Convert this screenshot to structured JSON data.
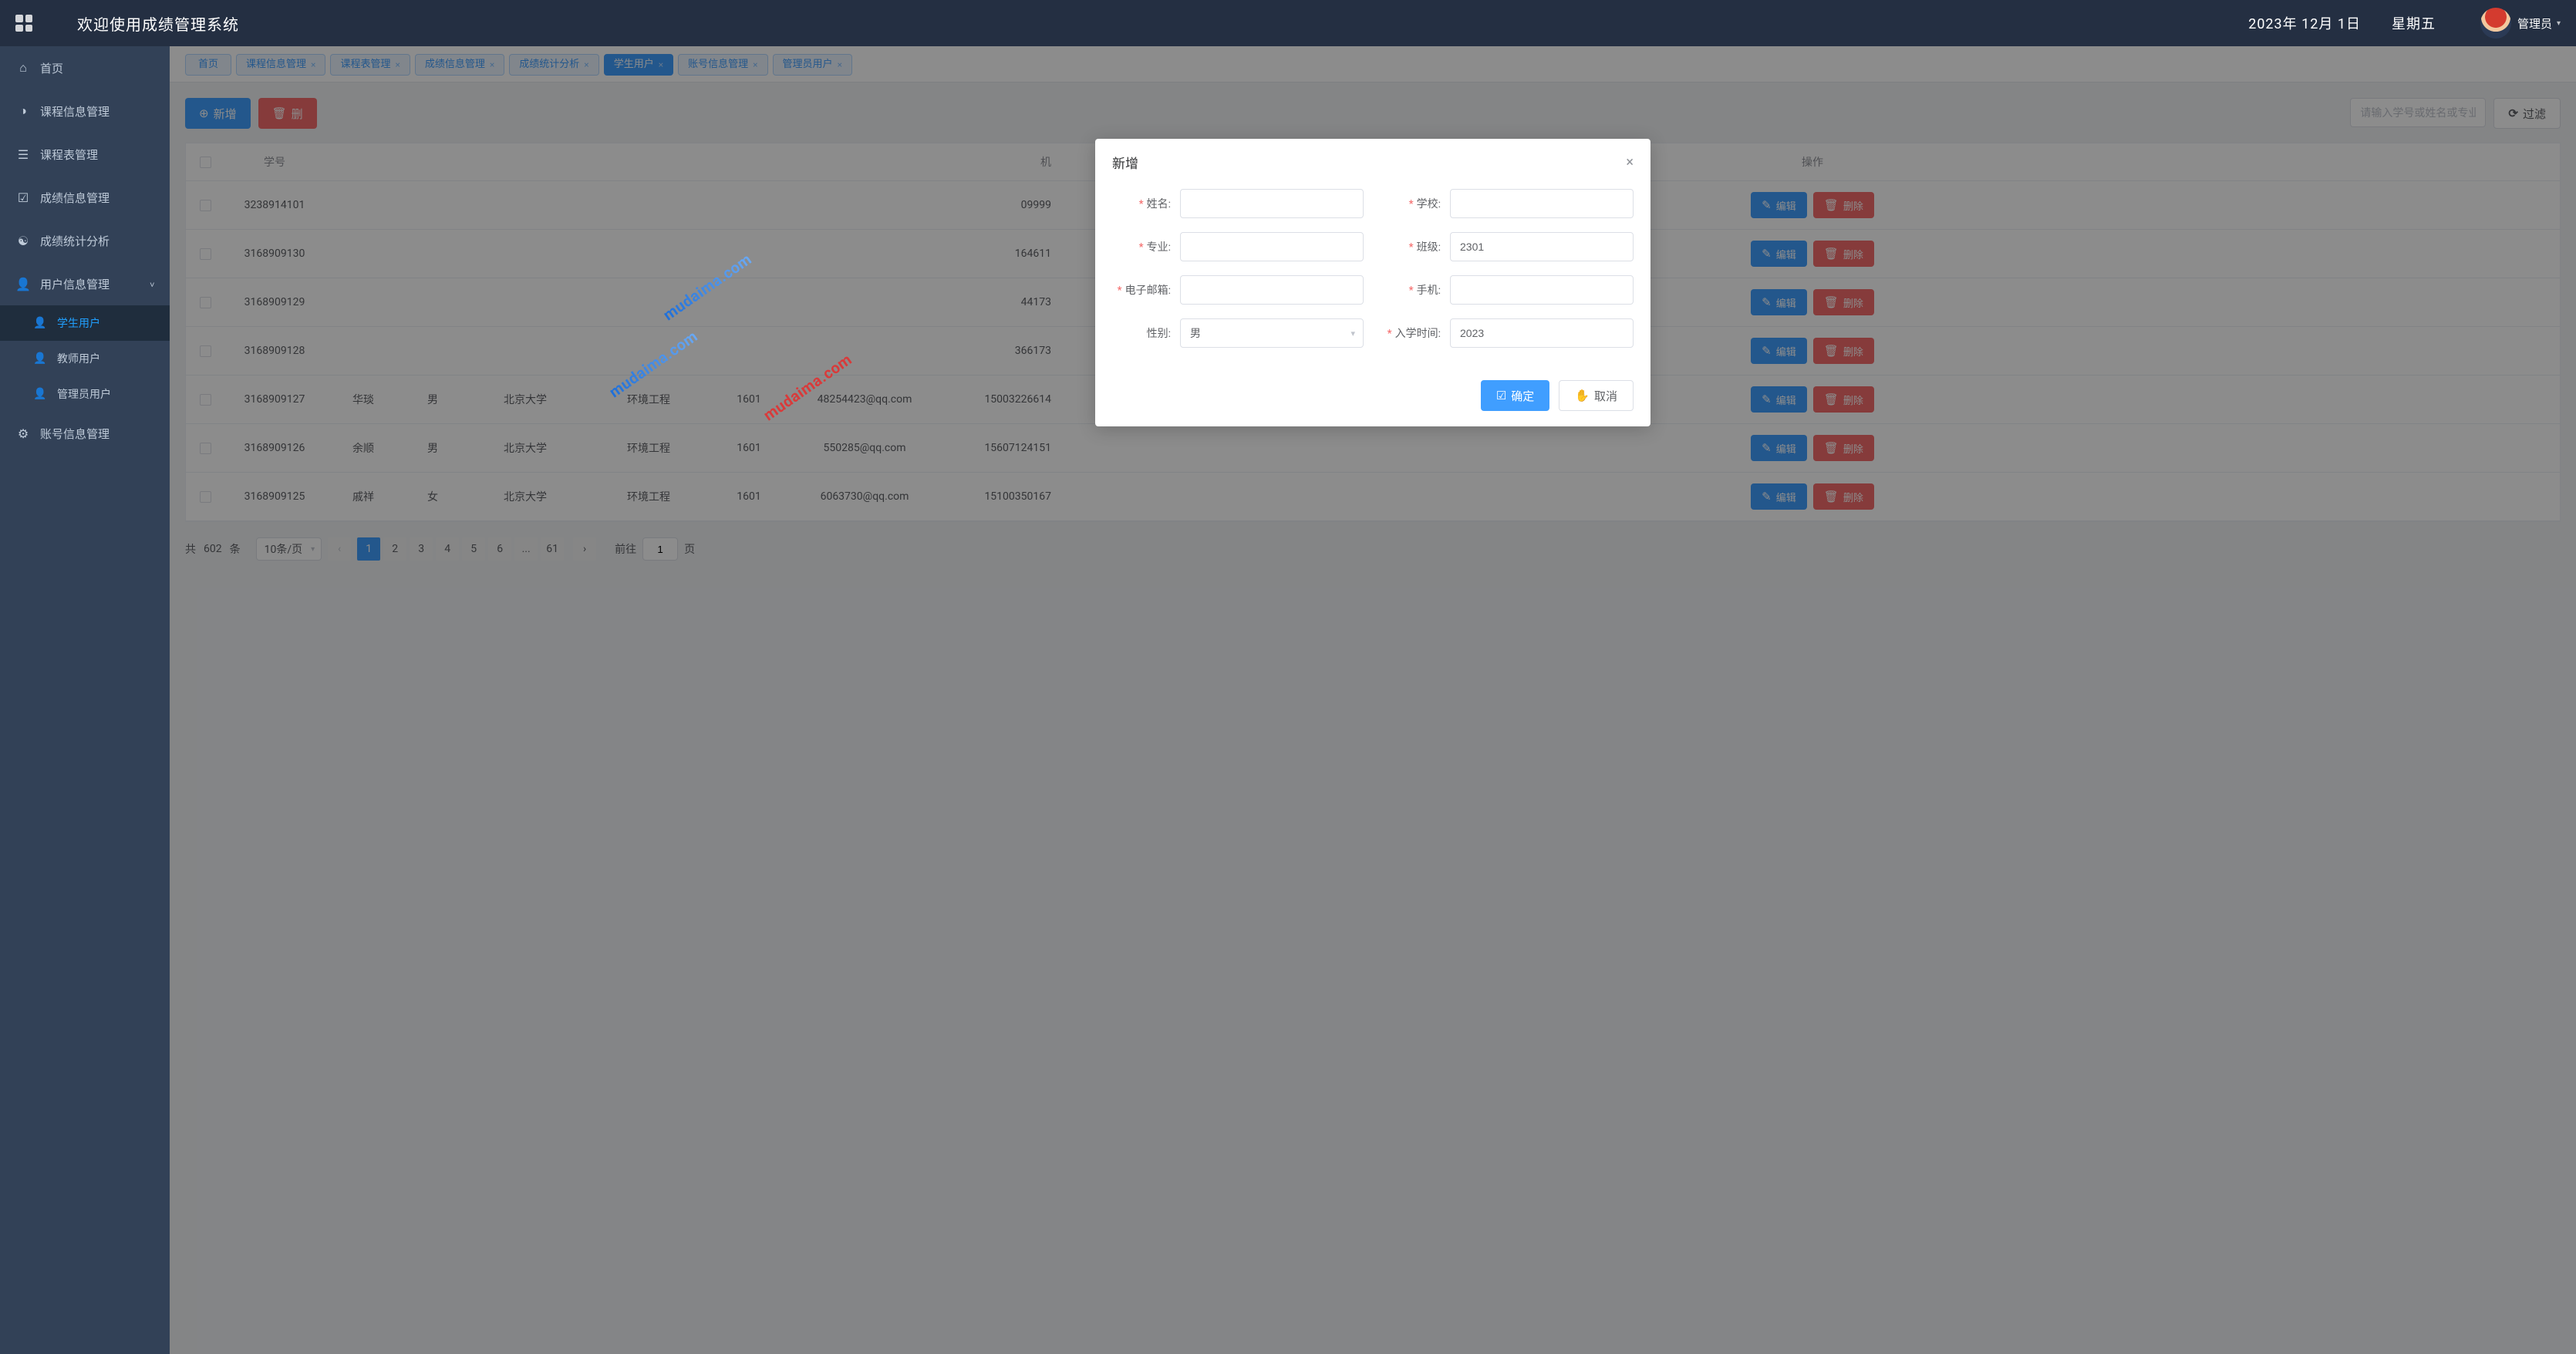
{
  "header": {
    "title": "欢迎使用成绩管理系统",
    "date": "2023年 12月 1日",
    "weekday": "星期五",
    "userName": "管理员"
  },
  "sidebar": {
    "items": [
      {
        "icon": "home",
        "label": "首页"
      },
      {
        "icon": "drop",
        "label": "课程信息管理"
      },
      {
        "icon": "list",
        "label": "课程表管理"
      },
      {
        "icon": "check",
        "label": "成绩信息管理"
      },
      {
        "icon": "analyze",
        "label": "成绩统计分析"
      },
      {
        "icon": "user",
        "label": "用户信息管理",
        "open": true
      },
      {
        "icon": "gear",
        "label": "账号信息管理"
      }
    ],
    "subItems": [
      {
        "label": "学生用户",
        "active": true
      },
      {
        "label": "教师用户"
      },
      {
        "label": "管理员用户"
      }
    ]
  },
  "tabs": [
    {
      "label": "首页",
      "closable": false
    },
    {
      "label": "课程信息管理",
      "closable": true
    },
    {
      "label": "课程表管理",
      "closable": true
    },
    {
      "label": "成绩信息管理",
      "closable": true
    },
    {
      "label": "成绩统计分析",
      "closable": true
    },
    {
      "label": "学生用户",
      "closable": true,
      "active": true
    },
    {
      "label": "账号信息管理",
      "closable": true
    },
    {
      "label": "管理员用户",
      "closable": true
    }
  ],
  "toolbar": {
    "add": "新增",
    "delete": "删",
    "searchPlaceholder": "请输入学号或姓名或专业",
    "filter": "过滤"
  },
  "table": {
    "headers": {
      "id": "学号",
      "phone_short": "机",
      "ops": "操作"
    },
    "rowActions": {
      "edit": "编辑",
      "delete": "删除"
    },
    "rows": [
      {
        "id": "3238914101",
        "name": "",
        "sex": "",
        "school": "",
        "major": "",
        "cls": "",
        "email": "",
        "phone": "09999"
      },
      {
        "id": "3168909130",
        "name": "",
        "sex": "",
        "school": "",
        "major": "",
        "cls": "",
        "email": "",
        "phone": "164611"
      },
      {
        "id": "3168909129",
        "name": "",
        "sex": "",
        "school": "",
        "major": "",
        "cls": "",
        "email": "",
        "phone": "44173"
      },
      {
        "id": "3168909128",
        "name": "",
        "sex": "",
        "school": "",
        "major": "",
        "cls": "",
        "email": "",
        "phone": "366173"
      },
      {
        "id": "3168909127",
        "name": "华琰",
        "sex": "男",
        "school": "北京大学",
        "major": "环境工程",
        "cls": "1601",
        "email": "48254423@qq.com",
        "phone": "15003226614"
      },
      {
        "id": "3168909126",
        "name": "余顺",
        "sex": "男",
        "school": "北京大学",
        "major": "环境工程",
        "cls": "1601",
        "email": "550285@qq.com",
        "phone": "15607124151"
      },
      {
        "id": "3168909125",
        "name": "戚祥",
        "sex": "女",
        "school": "北京大学",
        "major": "环境工程",
        "cls": "1601",
        "email": "6063730@qq.com",
        "phone": "15100350167"
      }
    ]
  },
  "pagination": {
    "totalPrefix": "共",
    "totalCount": "602",
    "totalSuffix": "条",
    "pageSize": "10条/页",
    "pages": [
      "1",
      "2",
      "3",
      "4",
      "5",
      "6",
      "...",
      "61"
    ],
    "currentPage": "1",
    "gotoLabel": "前往",
    "gotoValue": "1",
    "gotoSuffix": "页"
  },
  "dialog": {
    "title": "新增",
    "fields": {
      "name": {
        "label": "姓名:",
        "required": true,
        "value": ""
      },
      "school": {
        "label": "学校:",
        "required": true,
        "value": ""
      },
      "major": {
        "label": "专业:",
        "required": true,
        "value": ""
      },
      "cls": {
        "label": "班级:",
        "required": true,
        "value": "2301"
      },
      "email": {
        "label": "电子邮箱:",
        "required": true,
        "value": ""
      },
      "phone": {
        "label": "手机:",
        "required": true,
        "value": ""
      },
      "sex": {
        "label": "性别:",
        "required": false,
        "value": "男"
      },
      "enroll": {
        "label": "入学时间:",
        "required": true,
        "value": "2023"
      }
    },
    "confirm": "确定",
    "cancel": "取消"
  },
  "watermark": "mudaima.com"
}
